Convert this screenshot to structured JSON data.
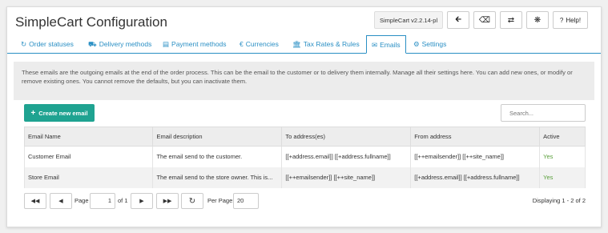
{
  "app": {
    "title": "SimpleCart Configuration",
    "version": "SimpleCart v2.2.14-pl"
  },
  "toolbar": {
    "help_label": "Help!"
  },
  "tabs": [
    {
      "label": "Order statuses",
      "icon": "refresh-icon"
    },
    {
      "label": "Delivery methods",
      "icon": "truck-icon"
    },
    {
      "label": "Payment methods",
      "icon": "credit-card-icon"
    },
    {
      "label": "Currencies",
      "icon": "euro-icon"
    },
    {
      "label": "Tax Rates & Rules",
      "icon": "bank-icon"
    },
    {
      "label": "Emails",
      "icon": "envelope-icon",
      "active": true
    },
    {
      "label": "Settings",
      "icon": "gear-icon"
    }
  ],
  "intro": "These emails are the outgoing emails at the end of the order process. This can be the email to the customer or to delivery them internally. Manage all their settings here. You can add new ones, or modify or remove existing ones. You cannot remove the defaults, but you can inactivate them.",
  "actions": {
    "create_label": "Create new email",
    "search_placeholder": "Search..."
  },
  "table": {
    "headers": [
      "Email Name",
      "Email description",
      "To address(es)",
      "From address",
      "Active"
    ],
    "rows": [
      [
        "Customer Email",
        "The email send to the customer.",
        "[[+address.email]] [[+address.fullname]]",
        "[[++emailsender]] [[++site_name]]",
        "Yes"
      ],
      [
        "Store Email",
        "The email send to the store owner. This is...",
        "[[++emailsender]] [[++site_name]]",
        "[[+address.email]] [[+address.fullname]]",
        "Yes"
      ]
    ]
  },
  "pager": {
    "page_label": "Page",
    "page_value": "1",
    "of_label": "of 1",
    "per_page_label": "Per Page:",
    "per_page_value": "20",
    "displaying": "Displaying 1 - 2 of 2"
  },
  "colors": {
    "accent": "#2a8fc4",
    "create_button": "#1fa391",
    "active_yes": "#5aa03c"
  }
}
